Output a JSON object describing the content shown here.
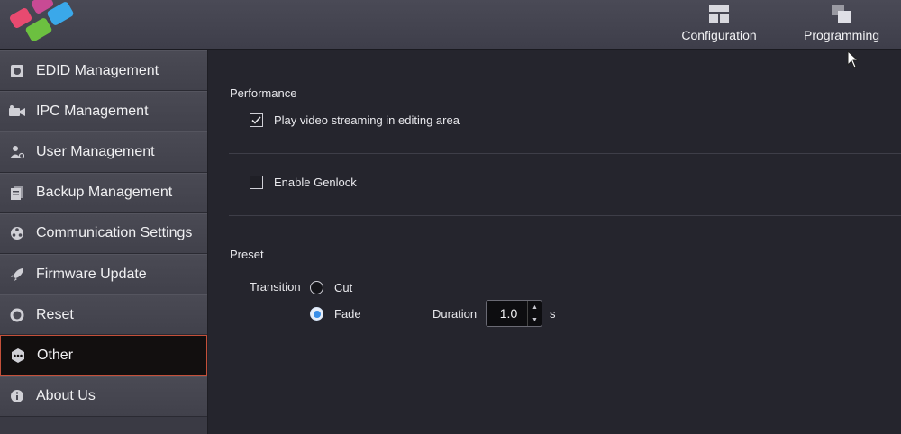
{
  "topbar": {
    "configuration_label": "Configuration",
    "programming_label": "Programming"
  },
  "sidebar": {
    "items": [
      {
        "label": "EDID Management",
        "icon": "edid-icon"
      },
      {
        "label": "IPC Management",
        "icon": "camera-icon"
      },
      {
        "label": "User Management",
        "icon": "user-icon"
      },
      {
        "label": "Backup Management",
        "icon": "backup-icon"
      },
      {
        "label": "Communication Settings",
        "icon": "network-icon"
      },
      {
        "label": "Firmware Update",
        "icon": "rocket-icon"
      },
      {
        "label": "Reset",
        "icon": "reset-icon"
      },
      {
        "label": "Other",
        "icon": "more-icon",
        "active": true
      },
      {
        "label": "About Us",
        "icon": "info-icon"
      }
    ]
  },
  "main": {
    "performance_title": "Performance",
    "play_video_label": "Play video streaming in editing area",
    "play_video_checked": true,
    "genlock_label": "Enable Genlock",
    "genlock_checked": false,
    "preset_title": "Preset",
    "transition_label": "Transition",
    "cut_label": "Cut",
    "fade_label": "Fade",
    "selected_transition": "Fade",
    "duration_label": "Duration",
    "duration_value": "1.0",
    "duration_unit": "s"
  },
  "colors": {
    "active_border": "#c4503a",
    "radio_selected": "#3a8fe8",
    "background": "#25252d"
  }
}
